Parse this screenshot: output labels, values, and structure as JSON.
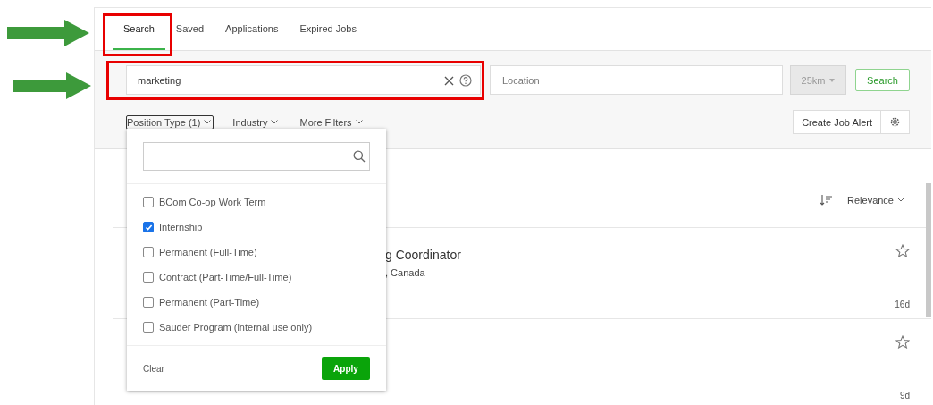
{
  "tabs": [
    {
      "label": "Search",
      "selected": true
    },
    {
      "label": "Saved",
      "selected": false
    },
    {
      "label": "Applications",
      "selected": false
    },
    {
      "label": "Expired Jobs",
      "selected": false
    }
  ],
  "search": {
    "keyword": "marketing",
    "location_placeholder": "Location",
    "radius": "25km",
    "button": "Search"
  },
  "filters": [
    {
      "label": "Position Type (1)",
      "expanded": true
    },
    {
      "label": "Industry",
      "expanded": false
    },
    {
      "label": "More Filters",
      "expanded": false
    }
  ],
  "create_alert": "Create Job Alert",
  "dropdown": {
    "options": [
      {
        "label": "BCom Co-op Work Term",
        "checked": false
      },
      {
        "label": "Internship",
        "checked": true
      },
      {
        "label": "Permanent (Full-Time)",
        "checked": false
      },
      {
        "label": "Contract (Part-Time/Full-Time)",
        "checked": false
      },
      {
        "label": "Permanent (Part-Time)",
        "checked": false
      },
      {
        "label": "Sauder Program (internal use only)",
        "checked": false
      }
    ],
    "clear": "Clear",
    "apply": "Apply"
  },
  "sort": "Relevance",
  "jobs": [
    {
      "title": "g Coordinator",
      "location": ", Canada",
      "age": "16d"
    },
    {
      "age": "9d"
    }
  ]
}
